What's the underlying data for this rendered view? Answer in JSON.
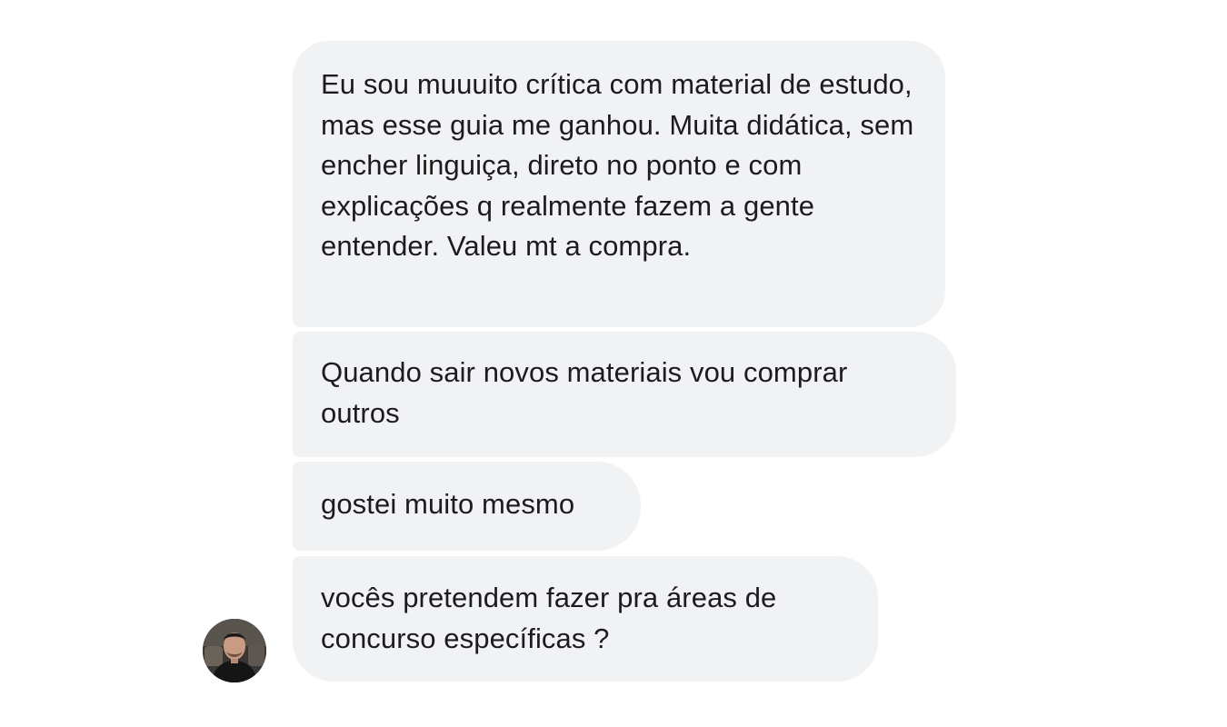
{
  "messages": [
    {
      "text": "Eu sou muuuito crítica com material de estudo, mas esse guia me ganhou. Muita didática, sem encher linguiça, direto no ponto e com explicações q realmente fazem a gente entender. Valeu mt a compra."
    },
    {
      "text": "Quando sair novos materiais vou comprar outros"
    },
    {
      "text": "gostei muito mesmo"
    },
    {
      "text": "vocês pretendem fazer pra áreas de concurso específicas ?"
    }
  ],
  "colors": {
    "bubble_background": "#f1f2f4",
    "text": "#1c1c1e",
    "page_background": "#ffffff"
  },
  "avatar": {
    "icon": "user-avatar-photo"
  }
}
